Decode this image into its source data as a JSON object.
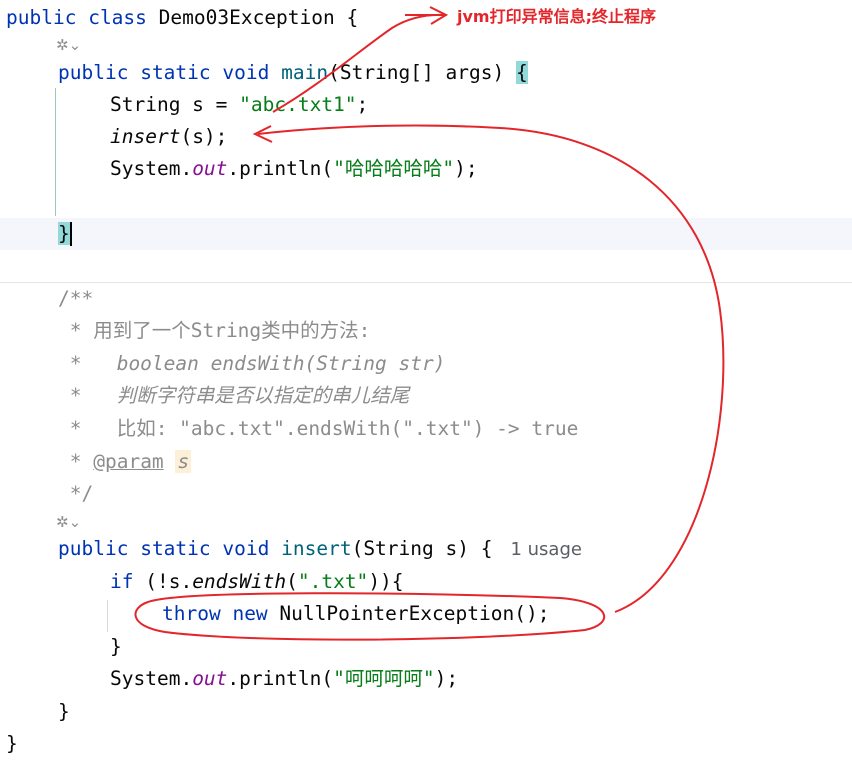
{
  "code": {
    "l1": {
      "k1": "public",
      "k2": "class",
      "rest": "Demo03Exception {"
    },
    "l3": {
      "k1": "public",
      "k2": "static",
      "k3": "void",
      "method": "main",
      "params": "(String[] args)",
      "brace": "{"
    },
    "l4": {
      "pre": "String s = ",
      "str": "\"abc.txt1\"",
      "post": ";"
    },
    "l5": {
      "call": "insert",
      "args": "(s);"
    },
    "l6": {
      "obj": "System.",
      "fld": "out",
      "call": ".println(",
      "str": "\"哈哈哈哈哈\"",
      "post": ");"
    },
    "l8": {
      "brace": "}"
    },
    "doc": {
      "open": "/**",
      "d1": " * 用到了一个String类中的方法:",
      "d2": " *   boolean endsWith(String str)",
      "d3": " *   判断字符串是否以指定的串儿结尾",
      "d4": " *   比如: \"abc.txt\".endsWith(\".txt\") -> true",
      "d5_pre": " * ",
      "d5_tag": "@param",
      "d5_param": "s",
      "close": " */"
    },
    "l17": {
      "k1": "public",
      "k2": "static",
      "k3": "void",
      "method": "insert",
      "params": "(String s) {",
      "usage": "1 usage"
    },
    "l18": {
      "kw": "if",
      "pre": " (!s.",
      "call": "endsWith",
      "open": "(",
      "str": "\".txt\"",
      "post": ")){"
    },
    "l19": {
      "kw": "throw",
      "kw2": "new",
      "rest": " NullPointerException();"
    },
    "l20": {
      "brace": "}"
    },
    "l21": {
      "obj": "System.",
      "fld": "out",
      "call": ".println(",
      "str": "\"呵呵呵呵\"",
      "post": ");"
    },
    "l22": {
      "brace": "}"
    },
    "l23": {
      "brace": "}"
    }
  },
  "gutter_icon": "ai-assistant-icon",
  "annotation": {
    "text": "jvm打印异常信息;终止程序",
    "color": "#e3262a"
  },
  "colors": {
    "keyword": "#0033b3",
    "string": "#067d17",
    "field": "#871094",
    "comment": "#8c8c8c",
    "bracket_match": "#93d9d9"
  }
}
